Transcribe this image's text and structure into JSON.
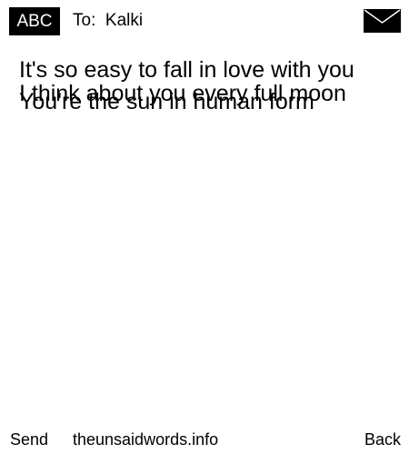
{
  "header": {
    "logo_text": "ABC",
    "recipient_label": "To:",
    "recipient_name": "Kalki",
    "envelope_icon": "envelope-icon"
  },
  "message": {
    "lines": [
      "It's so easy to fall in love with you",
      "I think about you every full moon",
      "You're the sun in human form"
    ]
  },
  "footer": {
    "send_label": "Send",
    "site_label": "theunsaidwords.info",
    "back_label": "Back"
  },
  "colors": {
    "background": "#ffffff",
    "text": "#000000",
    "badge_background": "#000000",
    "badge_text": "#ffffff"
  }
}
